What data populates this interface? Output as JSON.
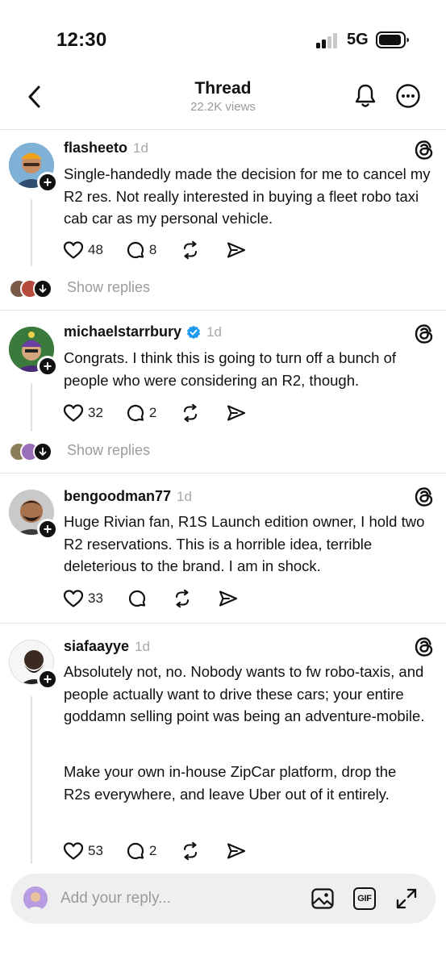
{
  "status_bar": {
    "time": "12:30",
    "network": "5G"
  },
  "header": {
    "title": "Thread",
    "views": "22.2K views"
  },
  "posts": [
    {
      "username": "flasheeto",
      "time": "1d",
      "verified": false,
      "text": "Single-handedly made the decision for me to cancel my R2 res. Not really interested in buying a fleet robo taxi cab car as my personal vehicle.",
      "likes": "48",
      "replies": "8",
      "show_replies": "Show replies"
    },
    {
      "username": "michaelstarrbury",
      "time": "1d",
      "verified": true,
      "text": "Congrats. I think this is going to turn off a bunch of people who were considering an R2, though.",
      "likes": "32",
      "replies": "2",
      "show_replies": "Show replies"
    },
    {
      "username": "bengoodman77",
      "time": "1d",
      "verified": false,
      "text": "Huge Rivian fan, R1S Launch edition owner, I hold two R2 reservations. This is a horrible idea, terrible deleterious to the brand. I am in shock.",
      "likes": "33",
      "replies": ""
    },
    {
      "username": "siafaayye",
      "time": "1d",
      "verified": false,
      "text": "Absolutely not, no. Nobody wants to fw robo-taxis, and people actually want to drive these cars; your entire goddamn selling point was being an adventure-mobile.",
      "text2": "Make your own in-house ZipCar platform, drop the R2s everywhere, and leave Uber out of it entirely.",
      "likes": "53",
      "replies": "2"
    }
  ],
  "reply_bar": {
    "placeholder": "Add your reply...",
    "gif_label": "GIF"
  },
  "colors": {
    "verified": "#1d9bf0",
    "muted": "#9a9a9a",
    "divider": "#e4e4e4"
  },
  "icons": [
    "back-chevron-icon",
    "bell-icon",
    "more-icon",
    "threads-logo-icon",
    "heart-icon",
    "comment-icon",
    "repost-icon",
    "share-icon",
    "image-icon",
    "gif-icon",
    "expand-icon"
  ]
}
